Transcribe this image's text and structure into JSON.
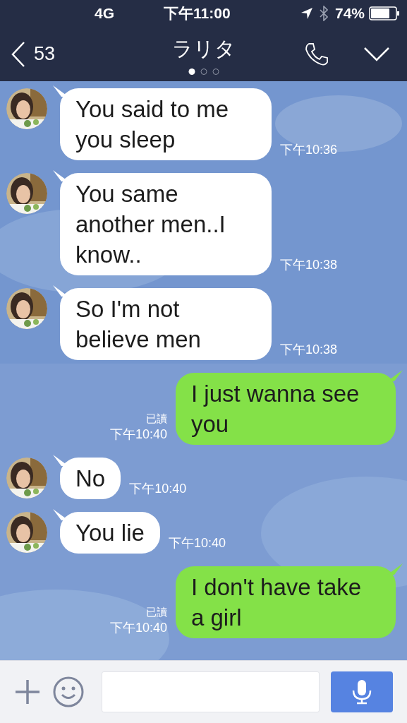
{
  "status_bar": {
    "network": "4G",
    "time": "下午11:00",
    "battery": "74%"
  },
  "header": {
    "back_count": "53",
    "title": "ラリタ",
    "page_dots": [
      {
        "selected": true
      },
      {
        "selected": false
      },
      {
        "selected": false
      }
    ]
  },
  "messages": [
    {
      "kind": "received",
      "text": "You said to me you sleep",
      "time": "下午10:36"
    },
    {
      "kind": "received",
      "text": "You same another men..I know..",
      "time": "下午10:38"
    },
    {
      "kind": "received",
      "text": "So I'm not believe men",
      "time": "下午10:38"
    },
    {
      "kind": "sent",
      "text": "I just wanna see you",
      "time": "下午10:40",
      "read": "已讀"
    },
    {
      "kind": "received",
      "text": "No",
      "time": "下午10:40"
    },
    {
      "kind": "received",
      "text": "You lie",
      "time": "下午10:40"
    },
    {
      "kind": "sent",
      "text": "I don't have take a girl",
      "time": "下午10:40",
      "read": "已讀"
    }
  ]
}
